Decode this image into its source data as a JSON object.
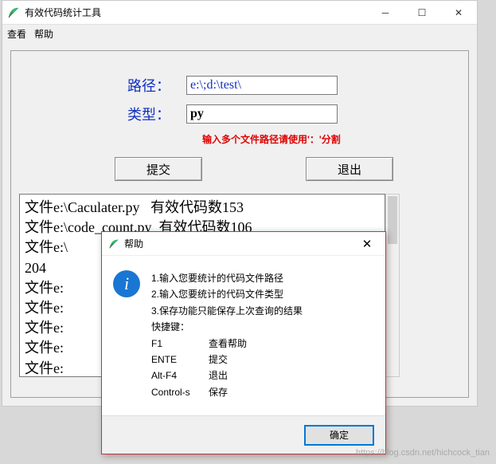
{
  "window": {
    "title": "有效代码统计工具",
    "menu": {
      "view": "查看",
      "help": "帮助"
    }
  },
  "form": {
    "path_label": "路径：",
    "path_value": "e:\\;d:\\test\\",
    "type_label": "类型：",
    "type_value": "py",
    "hint": "输入多个文件路径请使用'：'分割"
  },
  "buttons": {
    "submit": "提交",
    "exit": "退出"
  },
  "output": "文件e:\\Caculater.py   有效代码数153\n文件e:\\code_count.py  有效代码数106\n文件e:\\                         效代码数\n204\n文件e:\n文件e:\n文件e:\n文件e:\n文件e:\n文件e:",
  "dialog": {
    "title": "帮助",
    "lines": {
      "l1": "1.输入您要统计的代码文件路径",
      "l2": "2.输入您要统计的代码文件类型",
      "l3": "3.保存功能只能保存上次查询的结果",
      "shortcuts_label": "快捷键："
    },
    "shortcuts": {
      "f1_k": "F1",
      "f1_v": "查看帮助",
      "enter_k": "ENTE",
      "enter_v": "提交",
      "altf4_k": "Alt-F4",
      "altf4_v": "退出",
      "ctrls_k": "Control-s",
      "ctrls_v": "保存"
    },
    "ok": "确定"
  },
  "watermark": "https://blog.csdn.net/hichcock_tian"
}
